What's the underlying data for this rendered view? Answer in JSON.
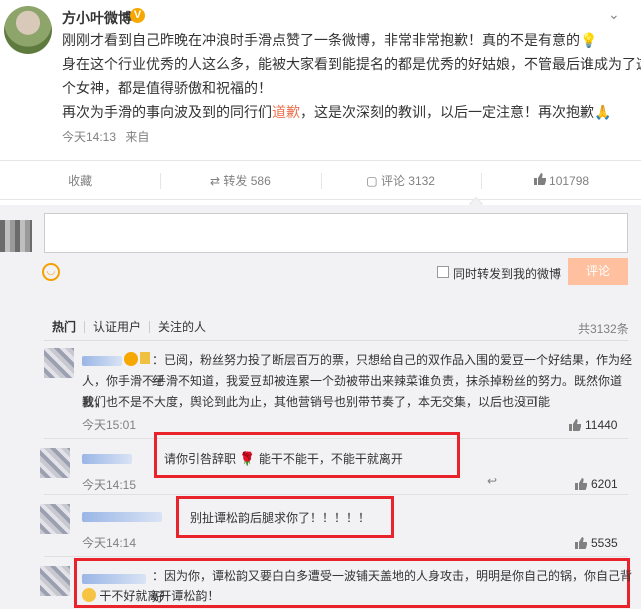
{
  "post": {
    "username": "方小叶微博",
    "badge": "V",
    "lines": [
      "刚刚才看到自己昨晚在冲浪时手滑点赞了一条微博，非常非常抱歉！真的不是有意的",
      "身在这个行业优秀的人这么多，能被大家看到能提名的都是优秀的好姑娘，不管最后谁成为了这",
      "个女神，都是值得骄傲和祝福的！"
    ],
    "line4_before": "再次为手滑的事向波及到的同行们",
    "line4_highlight": "道歉",
    "line4_after": "，这是次深刻的教训，以后一定注意！再次抱歉",
    "time": "今天14:13",
    "source": "来自"
  },
  "actions": {
    "favorite": "收藏",
    "repost": "转发 586",
    "comment": "评论 3132",
    "like": "101798"
  },
  "comment_box": {
    "also_repost": "同时转发到我的微博",
    "submit": "评论"
  },
  "tabs": [
    "热门",
    "认证用户",
    "关注的人"
  ],
  "total": "共3132条",
  "comments": [
    {
      "lines": [
        "：已阅，粉丝努力投了断层百万的票，只想给自己的双作品入围的爱豆一个好结果，作为经纪",
        "人，你手滑不手滑不知道，我爱豆却被连累一个劲被带出来辣菜谁负责，抹杀掉粉丝的努力。既然你道歉，",
        "我们也不是不大度，舆论到此为止，其他营销号也别带节奏了，本无交集，以后也没可能"
      ],
      "time": "今天15:01",
      "likes": "11440"
    },
    {
      "before": "请你引咎辞职",
      "after": "能干不能干，不能干就离开",
      "time": "今天14:15",
      "likes": "6201"
    },
    {
      "text": "别扯谭松韵后腿求你了！！！！！",
      "time": "今天14:14",
      "likes": "5535"
    },
    {
      "line1": "：因为你，谭松韵又要白白多遭受一波铺天盖地的人身攻击，明明是你自己的锅，你自己背好",
      "line2": "干不好就离开谭松韵！"
    }
  ]
}
